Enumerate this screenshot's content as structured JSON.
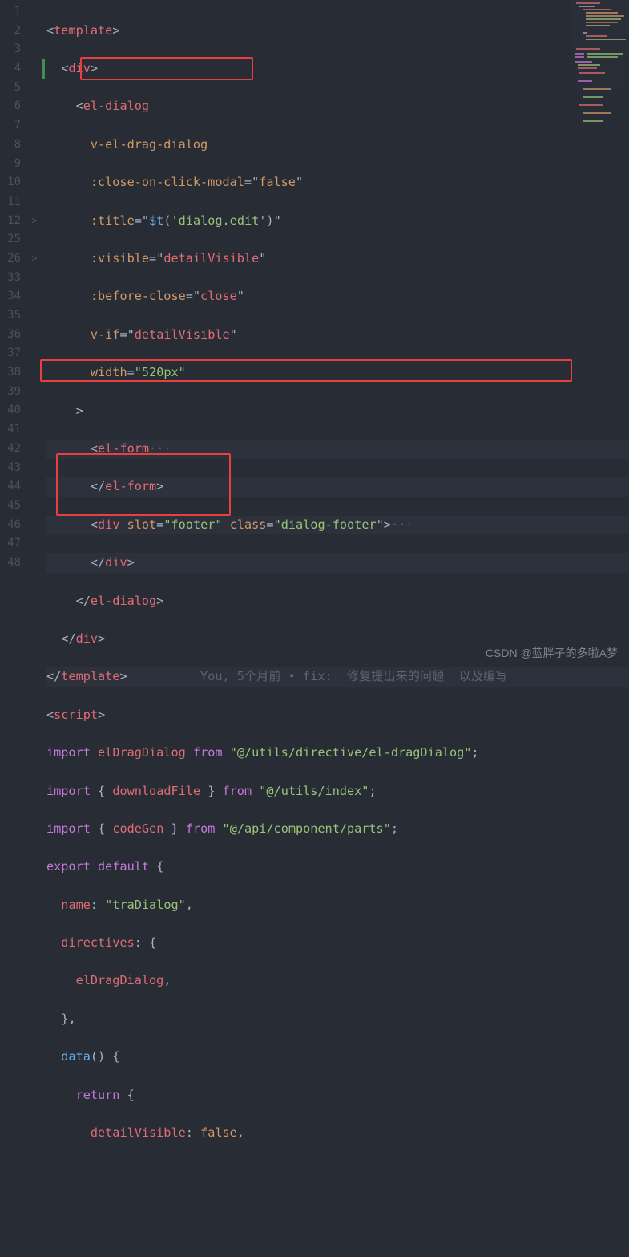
{
  "line_numbers": [
    "1",
    "2",
    "3",
    "4",
    "5",
    "6",
    "7",
    "8",
    "9",
    "10",
    "11",
    "12",
    "25",
    "26",
    "33",
    "34",
    "35",
    "36",
    "37",
    "38",
    "39",
    "40",
    "41",
    "42",
    "43",
    "44",
    "45",
    "46",
    "47",
    "48"
  ],
  "fold_markers": {
    "11": ">",
    "14": ">"
  },
  "mod_markers": {
    "3": "green"
  },
  "code": {
    "l1": {
      "open": "<",
      "tag": "template",
      "close": ">"
    },
    "l2": {
      "open": "<",
      "tag": "div",
      "close": ">"
    },
    "l3": {
      "open": "<",
      "tag": "el-dialog"
    },
    "l4": {
      "attr": "v-el-drag-dialog"
    },
    "l5": {
      "attr": ":close-on-click-modal",
      "eq": "=",
      "q": "\"",
      "val": "false",
      "q2": "\""
    },
    "l6": {
      "attr": ":title",
      "eq": "=",
      "q": "\"",
      "fn": "$t",
      "op": "(",
      "iq": "'",
      "ival": "dialog.edit",
      "iq2": "'",
      "cp": ")",
      "q2": "\""
    },
    "l7": {
      "attr": ":visible",
      "eq": "=",
      "q": "\"",
      "val": "detailVisible",
      "q2": "\""
    },
    "l8": {
      "attr": ":before-close",
      "eq": "=",
      "q": "\"",
      "val": "close",
      "q2": "\""
    },
    "l9": {
      "attr": "v-if",
      "eq": "=",
      "q": "\"",
      "val": "detailVisible",
      "q2": "\""
    },
    "l10": {
      "attr": "width",
      "eq": "=",
      "q": "\"",
      "val": "520px",
      "q2": "\""
    },
    "l11": {
      "close": ">"
    },
    "l12": {
      "open": "<",
      "tag": "el-form",
      "dots": "···"
    },
    "l13": {
      "open": "</",
      "tag": "el-form",
      "close": ">"
    },
    "l14": {
      "open": "<",
      "tag": "div",
      "sp": " ",
      "a1": "slot",
      "eq1": "=",
      "q1": "\"",
      "v1": "footer",
      "q1b": "\"",
      "sp2": " ",
      "a2": "class",
      "eq2": "=",
      "q2": "\"",
      "v2": "dialog-footer",
      "q2b": "\"",
      "close": ">",
      "dots": "···"
    },
    "l15": {
      "open": "</",
      "tag": "div",
      "close": ">"
    },
    "l16": {
      "open": "</",
      "tag": "el-dialog",
      "close": ">"
    },
    "l17": {
      "open": "</",
      "tag": "div",
      "close": ">"
    },
    "l18": {
      "open": "</",
      "tag": "template",
      "close": ">"
    },
    "blame": {
      "who": "You, ",
      "when": "5个月前",
      "sep": " • ",
      "msg": "fix:  修复提出来的问题  以及编写"
    },
    "l19": {
      "open": "<",
      "tag": "script",
      "close": ">"
    },
    "l20": {
      "kw": "import",
      "sp": " ",
      "id": "elDragDialog",
      "sp2": " ",
      "from": "from",
      "sp3": " ",
      "q": "\"",
      "path": "@/utils/directive/el-dragDialog",
      "q2": "\"",
      "semi": ";"
    },
    "l21": {
      "kw": "import",
      "sp": " ",
      "ob": "{ ",
      "id": "downloadFile",
      "cb": " }",
      "sp2": " ",
      "from": "from",
      "sp3": " ",
      "q": "\"",
      "path": "@/utils/index",
      "q2": "\"",
      "semi": ";"
    },
    "l22": {
      "kw": "import",
      "sp": " ",
      "ob": "{ ",
      "id": "codeGen",
      "cb": " }",
      "sp2": " ",
      "from": "from",
      "sp3": " ",
      "q": "\"",
      "path": "@/api/component/parts",
      "q2": "\"",
      "semi": ";"
    },
    "l23": {
      "kw1": "export",
      "sp": " ",
      "kw2": "default",
      "sp2": " ",
      "ob": "{"
    },
    "l24": {
      "prop": "name",
      "colon": ": ",
      "q": "\"",
      "val": "traDialog",
      "q2": "\"",
      "comma": ","
    },
    "l25": {
      "prop": "directives",
      "colon": ": ",
      "ob": "{"
    },
    "l26": {
      "id": "elDragDialog",
      "comma": ","
    },
    "l27": {
      "cb": "}",
      "comma": ","
    },
    "l28": {
      "fn": "data",
      "paren": "()",
      "sp": " ",
      "ob": "{"
    },
    "l29": {
      "kw": "return",
      "sp": " ",
      "ob": "{"
    },
    "l30": {
      "prop": "detailVisible",
      "colon": ": ",
      "val": "false",
      "comma": ","
    }
  },
  "watermark": "CSDN @蓝胖子的多啦A梦",
  "chart_data": null
}
